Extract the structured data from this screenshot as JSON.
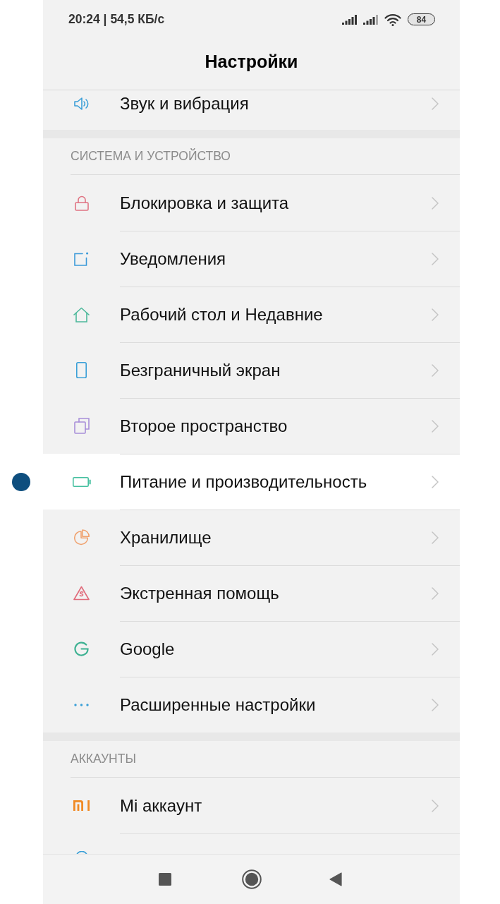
{
  "status_bar": {
    "time_speed": "20:24 | 54,5 КБ/с",
    "battery": "84"
  },
  "header": {
    "title": "Настройки"
  },
  "sections": [
    {
      "items": [
        {
          "label": "Звук и вибрация",
          "selected": false
        }
      ]
    },
    {
      "title": "СИСТЕМА И УСТРОЙСТВО",
      "items": [
        {
          "label": "Блокировка и защита",
          "selected": false
        },
        {
          "label": "Уведомления",
          "selected": false
        },
        {
          "label": "Рабочий стол и Недавние",
          "selected": false
        },
        {
          "label": "Безграничный экран",
          "selected": false
        },
        {
          "label": "Второе пространство",
          "selected": false
        },
        {
          "label": "Питание и производительность",
          "selected": true
        },
        {
          "label": "Хранилище",
          "selected": false
        },
        {
          "label": "Экстренная помощь",
          "selected": false
        },
        {
          "label": "Google",
          "selected": false
        },
        {
          "label": "Расширенные настройки",
          "selected": false
        }
      ]
    },
    {
      "title": "АККАУНТЫ",
      "items": [
        {
          "label": "Mi аккаунт",
          "selected": false
        }
      ]
    }
  ]
}
